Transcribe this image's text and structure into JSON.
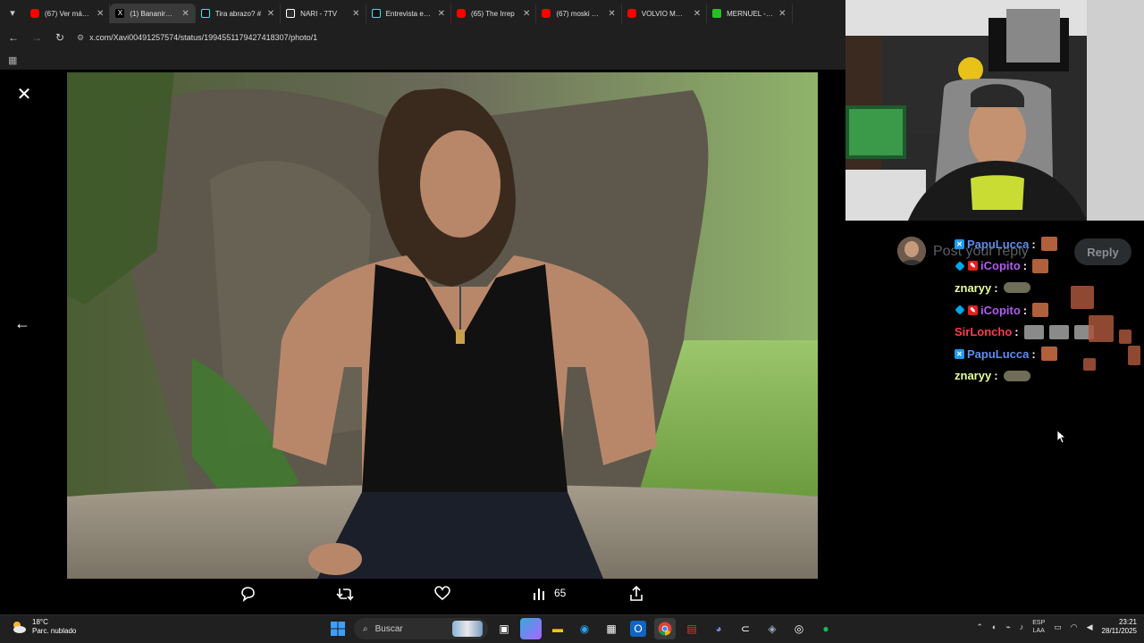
{
  "browser": {
    "tabs": [
      {
        "label": "(67) Ver más ta",
        "favicon": "youtube-icon"
      },
      {
        "label": "(1) Bananirou C",
        "favicon": "x-icon",
        "active": true
      },
      {
        "label": "Tira abrazo? #",
        "favicon": "tiktok-icon"
      },
      {
        "label": "NARI - 7TV",
        "favicon": "7tv-icon"
      },
      {
        "label": "Entrevista excl",
        "favicon": "tiktok-icon"
      },
      {
        "label": "(65) The Irrep",
        "favicon": "youtube-icon"
      },
      {
        "label": "(67) moski es g",
        "favicon": "youtube-icon"
      },
      {
        "label": "VOLVIO MOSK",
        "favicon": "youtube-icon"
      },
      {
        "label": "MERNUEL - W",
        "favicon": "kick-icon"
      }
    ],
    "url": "x.com/Xavi00491257574/status/1994551179427418307/photo/1"
  },
  "viewer": {
    "actions": {
      "views": "65"
    }
  },
  "chat": {
    "reply_placeholder": "Post your reply",
    "reply_button": "Reply",
    "messages": [
      {
        "user": "PapuLucca",
        "color": "#5b8def",
        "badges": [
          "twitter"
        ]
      },
      {
        "user": "iCopito",
        "color": "#b05cf0",
        "badges": [
          "diamond",
          "pencil"
        ]
      },
      {
        "user": "znaryy",
        "color": "#e8ff9a",
        "badges": []
      },
      {
        "user": "iCopito",
        "color": "#b05cf0",
        "badges": [
          "diamond",
          "pencil"
        ]
      },
      {
        "user": "SirLoncho",
        "color": "#ff3b4a",
        "badges": []
      },
      {
        "user": "PapuLucca",
        "color": "#5b8def",
        "badges": [
          "twitter"
        ]
      },
      {
        "user": "znaryy",
        "color": "#e8ff9a",
        "badges": []
      }
    ],
    "separator": ":"
  },
  "taskbar": {
    "weather": {
      "temp": "18°C",
      "desc": "Parc. nublado"
    },
    "search_placeholder": "Buscar",
    "lang": {
      "line1": "ESP",
      "line2": "LAA"
    },
    "clock": {
      "time": "23:21",
      "date": "28/11/2025"
    }
  },
  "colors": {
    "accent": "#1d9bf0",
    "background": "#000000"
  }
}
